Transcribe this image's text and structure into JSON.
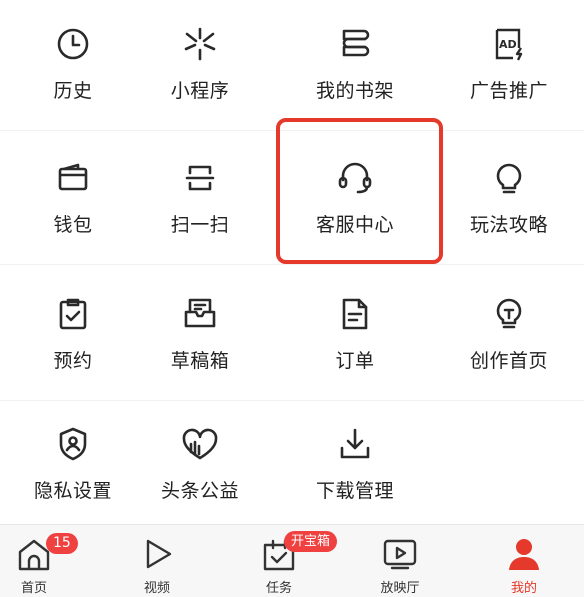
{
  "grid": {
    "rows": [
      [
        {
          "label": "历史",
          "icon": "clock-icon"
        },
        {
          "label": "小程序",
          "icon": "mini-program-icon"
        },
        {
          "label": "我的书架",
          "icon": "bookshelf-icon"
        },
        {
          "label": "广告推广",
          "icon": "ad-icon"
        }
      ],
      [
        {
          "label": "钱包",
          "icon": "wallet-icon"
        },
        {
          "label": "扫一扫",
          "icon": "scan-icon"
        },
        {
          "label": "客服中心",
          "icon": "headset-icon"
        },
        {
          "label": "玩法攻略",
          "icon": "lightbulb-icon"
        }
      ],
      [
        {
          "label": "预约",
          "icon": "clipboard-check-icon"
        },
        {
          "label": "草稿箱",
          "icon": "drafts-icon"
        },
        {
          "label": "订单",
          "icon": "order-document-icon"
        },
        {
          "label": "创作首页",
          "icon": "creator-bulb-icon"
        }
      ],
      [
        {
          "label": "隐私设置",
          "icon": "shield-user-icon"
        },
        {
          "label": "头条公益",
          "icon": "charity-heart-icon"
        },
        {
          "label": "下载管理",
          "icon": "download-icon"
        }
      ]
    ]
  },
  "tabbar": {
    "tabs": [
      {
        "label": "首页",
        "icon": "home-icon",
        "badge": "15"
      },
      {
        "label": "视频",
        "icon": "play-icon"
      },
      {
        "label": "任务",
        "icon": "task-icon",
        "badge": "开宝箱"
      },
      {
        "label": "放映厅",
        "icon": "tv-play-icon"
      },
      {
        "label": "我的",
        "icon": "user-icon",
        "active": true
      }
    ]
  },
  "colors": {
    "accent": "#e4392b",
    "badge": "#f04141",
    "icon": "#2a2a2a"
  }
}
